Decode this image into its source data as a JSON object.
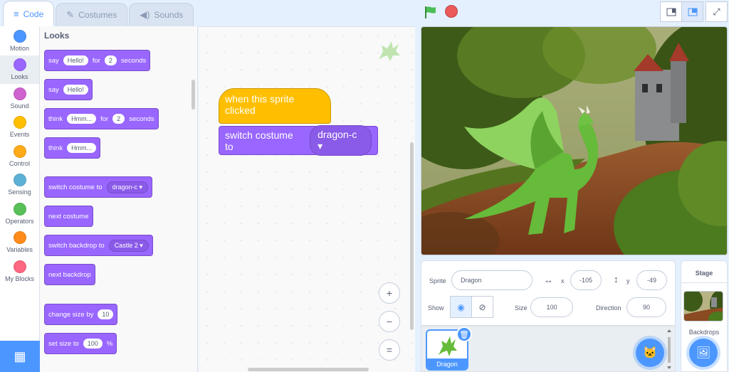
{
  "tabs": [
    {
      "label": "Code",
      "icon": "code-icon"
    },
    {
      "label": "Costumes",
      "icon": "brush-icon"
    },
    {
      "label": "Sounds",
      "icon": "speaker-icon"
    }
  ],
  "categories": [
    {
      "label": "Motion",
      "color": "#4c97ff"
    },
    {
      "label": "Looks",
      "color": "#9966ff"
    },
    {
      "label": "Sound",
      "color": "#cf63cf"
    },
    {
      "label": "Events",
      "color": "#ffbf00"
    },
    {
      "label": "Control",
      "color": "#ffab19"
    },
    {
      "label": "Sensing",
      "color": "#5cb1d6"
    },
    {
      "label": "Operators",
      "color": "#59c059"
    },
    {
      "label": "Variables",
      "color": "#ff8c1a"
    },
    {
      "label": "My Blocks",
      "color": "#ff6680"
    }
  ],
  "palette": {
    "title": "Looks",
    "say_for": {
      "say": "say",
      "msg": "Hello!",
      "for": "for",
      "secs": "2",
      "seconds": "seconds"
    },
    "say": {
      "say": "say",
      "msg": "Hello!"
    },
    "think_for": {
      "think": "think",
      "msg": "Hmm...",
      "for": "for",
      "secs": "2",
      "seconds": "seconds"
    },
    "think": {
      "think": "think",
      "msg": "Hmm..."
    },
    "switch_costume": {
      "label": "switch costume to",
      "value": "dragon-c"
    },
    "next_costume": "next costume",
    "switch_backdrop": {
      "label": "switch backdrop to",
      "value": "Castle 2"
    },
    "next_backdrop": "next backdrop",
    "change_size": {
      "label": "change size by",
      "value": "10"
    },
    "set_size": {
      "label": "set size to",
      "value": "100",
      "unit": "%"
    }
  },
  "script": {
    "hat": "when this sprite clicked",
    "switch_label": "switch costume to",
    "switch_value": "dragon-c"
  },
  "zoom": {
    "zoom_in": "+",
    "zoom_out": "−",
    "reset": "="
  },
  "sprite_info": {
    "sprite_label": "Sprite",
    "sprite_name": "Dragon",
    "x_label": "x",
    "x": "-105",
    "y_label": "y",
    "y": "-49",
    "show_label": "Show",
    "size_label": "Size",
    "size": "100",
    "direction_label": "Direction",
    "direction": "90"
  },
  "sprites": [
    {
      "name": "Dragon"
    }
  ],
  "stage_panel": {
    "title": "Stage",
    "backdrops_label": "Backdrops"
  },
  "colors": {
    "accent": "#4c97ff",
    "looks": "#9966ff",
    "events": "#ffbf00",
    "flag": "#4cbf56",
    "stop": "#ec5959"
  }
}
